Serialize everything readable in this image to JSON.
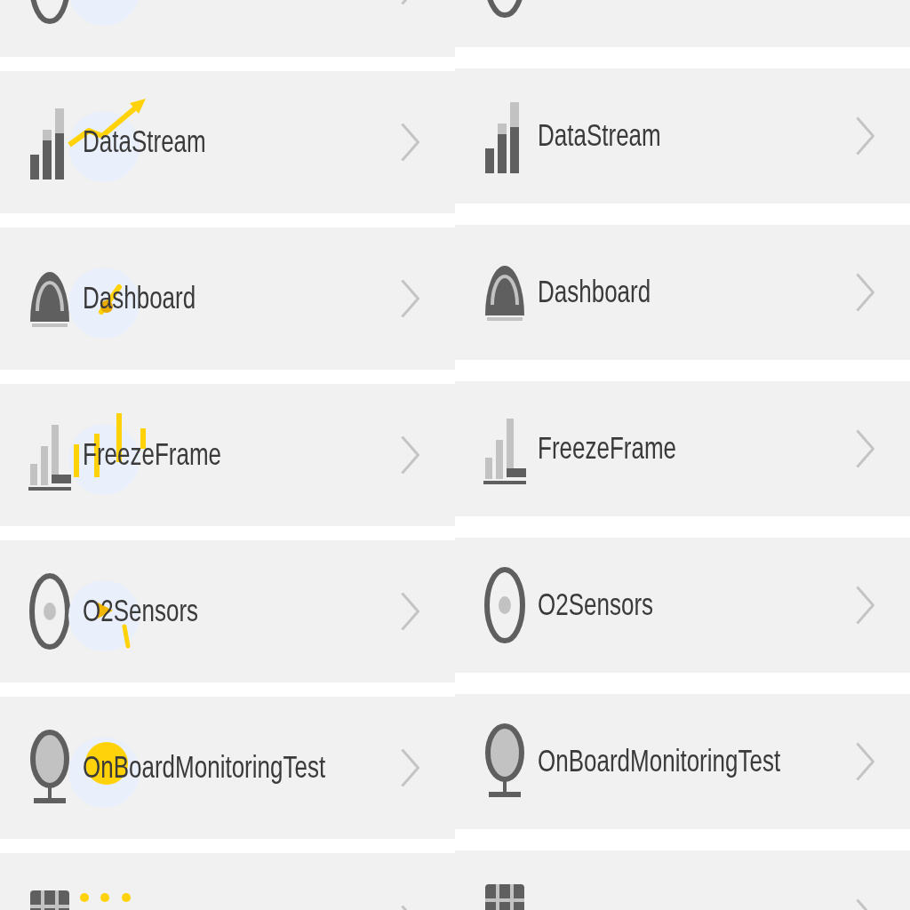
{
  "columns": [
    {
      "kind": "accented",
      "items": [
        {
          "kind": "gauge"
        },
        {
          "kind": "chart",
          "label": "DataStream"
        },
        {
          "kind": "dashboard",
          "label": "Dashboard"
        },
        {
          "kind": "freeze",
          "label": "FreezeFrame"
        },
        {
          "kind": "sensor",
          "label": "O2Sensors"
        },
        {
          "kind": "monitor",
          "label": "OnBoardMonitoringTest"
        },
        {
          "kind": "info"
        }
      ]
    },
    {
      "kind": "plain",
      "items": [
        {
          "kind": "gauge"
        },
        {
          "kind": "chart",
          "label": "DataStream"
        },
        {
          "kind": "dashboard",
          "label": "Dashboard"
        },
        {
          "kind": "freeze",
          "label": "FreezeFrame"
        },
        {
          "kind": "sensor",
          "label": "O2Sensors"
        },
        {
          "kind": "monitor",
          "label": "OnBoardMonitoringTest"
        },
        {
          "kind": "info"
        }
      ]
    }
  ]
}
